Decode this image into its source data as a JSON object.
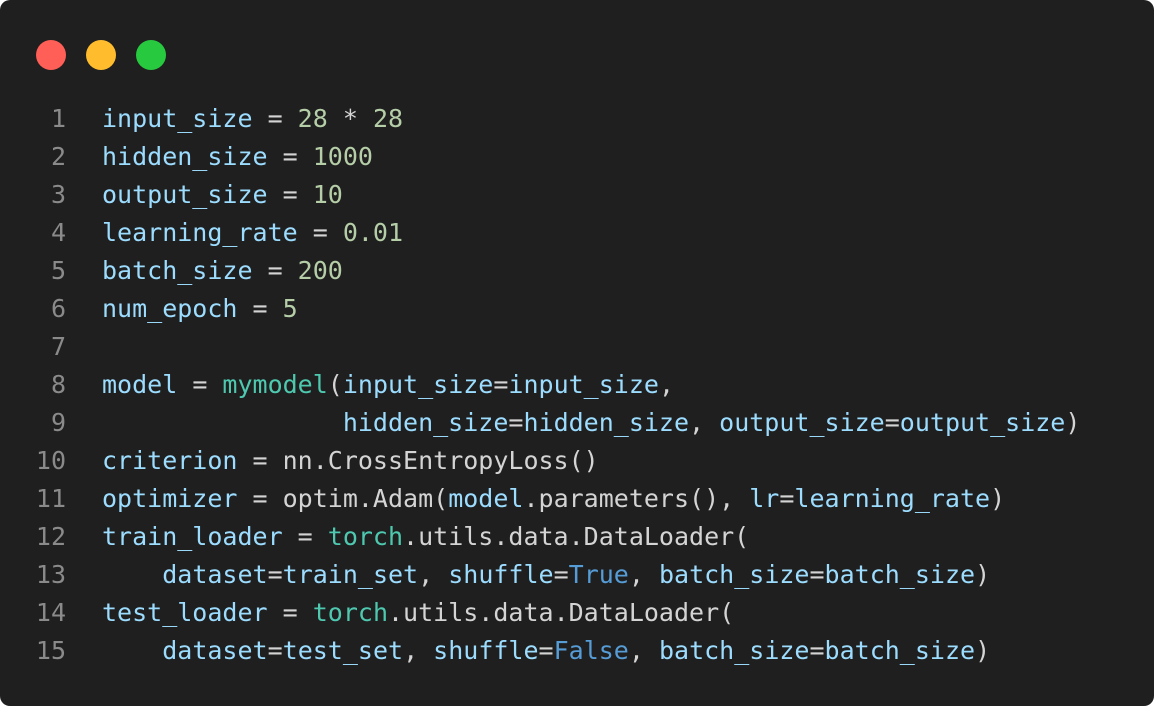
{
  "colors": {
    "background": "#1f1f1f",
    "dot_close": "#ff5f56",
    "dot_minimize": "#ffbd2e",
    "dot_maximize": "#27c93f",
    "line_number": "#8a8a8a",
    "variable": "#9cdcfe",
    "number": "#b5cea8",
    "plain": "#d4d4d4",
    "class_name": "#4ec9b0",
    "keyword": "#569cd6"
  },
  "code": {
    "lines": [
      {
        "number": "1",
        "tokens": [
          {
            "t": "input_size",
            "c": "var"
          },
          {
            "t": " = ",
            "c": "op"
          },
          {
            "t": "28",
            "c": "num"
          },
          {
            "t": " * ",
            "c": "op"
          },
          {
            "t": "28",
            "c": "num"
          }
        ]
      },
      {
        "number": "2",
        "tokens": [
          {
            "t": "hidden_size",
            "c": "var"
          },
          {
            "t": " = ",
            "c": "op"
          },
          {
            "t": "1000",
            "c": "num"
          }
        ]
      },
      {
        "number": "3",
        "tokens": [
          {
            "t": "output_size",
            "c": "var"
          },
          {
            "t": " = ",
            "c": "op"
          },
          {
            "t": "10",
            "c": "num"
          }
        ]
      },
      {
        "number": "4",
        "tokens": [
          {
            "t": "learning_rate",
            "c": "var"
          },
          {
            "t": " = ",
            "c": "op"
          },
          {
            "t": "0.01",
            "c": "num"
          }
        ]
      },
      {
        "number": "5",
        "tokens": [
          {
            "t": "batch_size",
            "c": "var"
          },
          {
            "t": " = ",
            "c": "op"
          },
          {
            "t": "200",
            "c": "num"
          }
        ]
      },
      {
        "number": "6",
        "tokens": [
          {
            "t": "num_epoch",
            "c": "var"
          },
          {
            "t": " = ",
            "c": "op"
          },
          {
            "t": "5",
            "c": "num"
          }
        ]
      },
      {
        "number": "7",
        "tokens": []
      },
      {
        "number": "8",
        "tokens": [
          {
            "t": "model",
            "c": "var"
          },
          {
            "t": " = ",
            "c": "op"
          },
          {
            "t": "mymodel",
            "c": "fn"
          },
          {
            "t": "(",
            "c": "pl"
          },
          {
            "t": "input_size",
            "c": "var"
          },
          {
            "t": "=",
            "c": "op"
          },
          {
            "t": "input_size",
            "c": "var"
          },
          {
            "t": ",",
            "c": "pl"
          }
        ]
      },
      {
        "number": "9",
        "tokens": [
          {
            "t": "                ",
            "c": "pl"
          },
          {
            "t": "hidden_size",
            "c": "var"
          },
          {
            "t": "=",
            "c": "op"
          },
          {
            "t": "hidden_size",
            "c": "var"
          },
          {
            "t": ", ",
            "c": "pl"
          },
          {
            "t": "output_size",
            "c": "var"
          },
          {
            "t": "=",
            "c": "op"
          },
          {
            "t": "output_size",
            "c": "var"
          },
          {
            "t": ")",
            "c": "pl"
          }
        ]
      },
      {
        "number": "10",
        "tokens": [
          {
            "t": "criterion",
            "c": "var"
          },
          {
            "t": " = ",
            "c": "op"
          },
          {
            "t": "nn.CrossEntropyLoss()",
            "c": "pl"
          }
        ]
      },
      {
        "number": "11",
        "tokens": [
          {
            "t": "optimizer",
            "c": "var"
          },
          {
            "t": " = ",
            "c": "op"
          },
          {
            "t": "optim.Adam(",
            "c": "pl"
          },
          {
            "t": "model",
            "c": "var"
          },
          {
            "t": ".parameters(), ",
            "c": "pl"
          },
          {
            "t": "lr",
            "c": "var"
          },
          {
            "t": "=",
            "c": "op"
          },
          {
            "t": "learning_rate",
            "c": "var"
          },
          {
            "t": ")",
            "c": "pl"
          }
        ]
      },
      {
        "number": "12",
        "tokens": [
          {
            "t": "train_loader",
            "c": "var"
          },
          {
            "t": " = ",
            "c": "op"
          },
          {
            "t": "torch",
            "c": "fn"
          },
          {
            "t": ".utils.data.DataLoader(",
            "c": "pl"
          }
        ]
      },
      {
        "number": "13",
        "tokens": [
          {
            "t": "    ",
            "c": "pl"
          },
          {
            "t": "dataset",
            "c": "var"
          },
          {
            "t": "=",
            "c": "op"
          },
          {
            "t": "train_set",
            "c": "var"
          },
          {
            "t": ", ",
            "c": "pl"
          },
          {
            "t": "shuffle",
            "c": "var"
          },
          {
            "t": "=",
            "c": "op"
          },
          {
            "t": "True",
            "c": "kw"
          },
          {
            "t": ", ",
            "c": "pl"
          },
          {
            "t": "batch_size",
            "c": "var"
          },
          {
            "t": "=",
            "c": "op"
          },
          {
            "t": "batch_size",
            "c": "var"
          },
          {
            "t": ")",
            "c": "pl"
          }
        ]
      },
      {
        "number": "14",
        "tokens": [
          {
            "t": "test_loader",
            "c": "var"
          },
          {
            "t": " = ",
            "c": "op"
          },
          {
            "t": "torch",
            "c": "fn"
          },
          {
            "t": ".utils.data.DataLoader(",
            "c": "pl"
          }
        ]
      },
      {
        "number": "15",
        "tokens": [
          {
            "t": "    ",
            "c": "pl"
          },
          {
            "t": "dataset",
            "c": "var"
          },
          {
            "t": "=",
            "c": "op"
          },
          {
            "t": "test_set",
            "c": "var"
          },
          {
            "t": ", ",
            "c": "pl"
          },
          {
            "t": "shuffle",
            "c": "var"
          },
          {
            "t": "=",
            "c": "op"
          },
          {
            "t": "False",
            "c": "kw"
          },
          {
            "t": ", ",
            "c": "pl"
          },
          {
            "t": "batch_size",
            "c": "var"
          },
          {
            "t": "=",
            "c": "op"
          },
          {
            "t": "batch_size",
            "c": "var"
          },
          {
            "t": ")",
            "c": "pl"
          }
        ]
      }
    ]
  }
}
